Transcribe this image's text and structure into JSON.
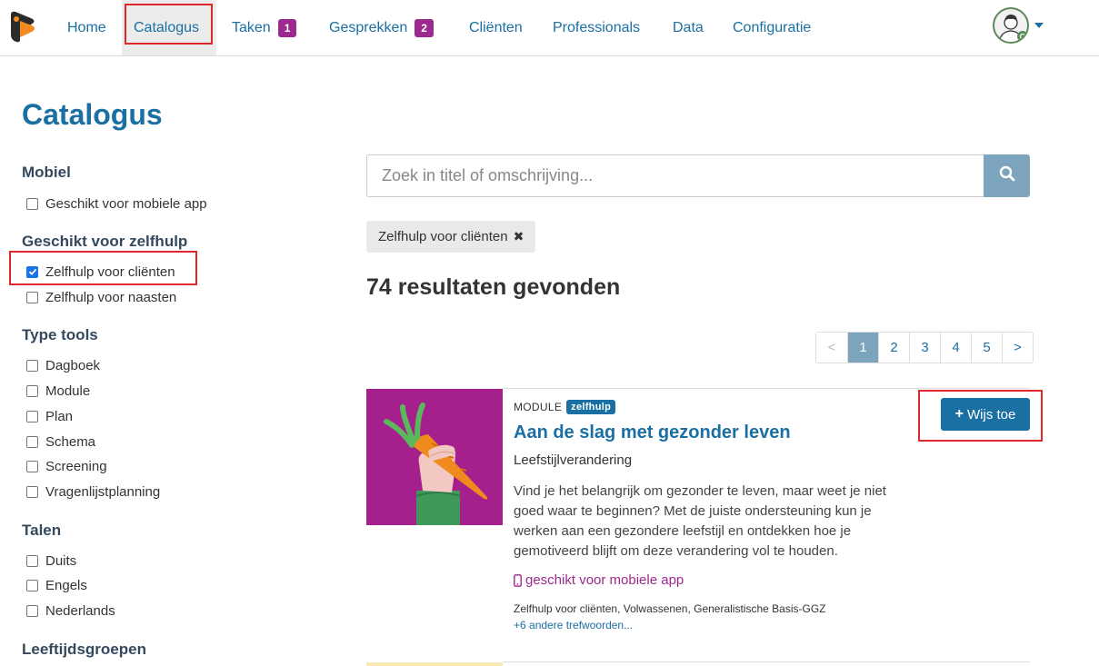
{
  "nav": {
    "items": [
      {
        "label": "Home"
      },
      {
        "label": "Catalogus"
      },
      {
        "label": "Taken",
        "badge": "1"
      },
      {
        "label": "Gesprekken",
        "badge": "2"
      },
      {
        "label": "Cliënten"
      },
      {
        "label": "Professionals"
      },
      {
        "label": "Data"
      },
      {
        "label": "Configuratie"
      }
    ],
    "active": "Catalogus"
  },
  "page": {
    "title": "Catalogus"
  },
  "filters": [
    {
      "heading": "Mobiel",
      "options": [
        {
          "label": "Geschikt voor mobiele app",
          "checked": false
        }
      ]
    },
    {
      "heading": "Geschikt voor zelfhulp",
      "options": [
        {
          "label": "Zelfhulp voor cliënten",
          "checked": true
        },
        {
          "label": "Zelfhulp voor naasten",
          "checked": false
        }
      ]
    },
    {
      "heading": "Type tools",
      "options": [
        {
          "label": "Dagboek",
          "checked": false
        },
        {
          "label": "Module",
          "checked": false
        },
        {
          "label": "Plan",
          "checked": false
        },
        {
          "label": "Schema",
          "checked": false
        },
        {
          "label": "Screening",
          "checked": false
        },
        {
          "label": "Vragenlijstplanning",
          "checked": false
        }
      ]
    },
    {
      "heading": "Talen",
      "options": [
        {
          "label": "Duits",
          "checked": false
        },
        {
          "label": "Engels",
          "checked": false
        },
        {
          "label": "Nederlands",
          "checked": false
        }
      ]
    },
    {
      "heading": "Leeftijdsgroepen",
      "options": []
    }
  ],
  "search": {
    "placeholder": "Zoek in titel of omschrijving...",
    "value": ""
  },
  "active_filter": {
    "label": "Zelfhulp voor cliënten",
    "remove_glyph": "✖"
  },
  "results": {
    "count_text": "74 resultaten gevonden"
  },
  "pagination": {
    "prev": "<",
    "next": ">",
    "pages": [
      "1",
      "2",
      "3",
      "4",
      "5"
    ],
    "current": "1"
  },
  "card": {
    "type": "MODULE",
    "badge": "zelfhulp",
    "title": "Aan de slag met gezonder leven",
    "subtitle": "Leefstijlverandering",
    "description": "Vind je het belangrijk om gezonder te leven, maar weet je niet goed waar te beginnen? Met de juiste ondersteuning kun je werken aan een gezondere leefstijl en ontdekken hoe je gemotiveerd blijft om deze verandering vol te houden.",
    "mobile_label": "geschikt voor mobiele app",
    "tags": "Zelfhulp voor cliënten, Volwassenen, Generalistische Basis-GGZ",
    "more_tags": "+6 andere trefwoorden...",
    "button_label": "Wijs toe",
    "button_icon": "+"
  },
  "colors": {
    "primary": "#1a6fa3",
    "badge": "#9c2a8e",
    "card_image_bg": "#a6208d",
    "search_button": "#7ca4bd",
    "highlight": "#e0272b"
  },
  "icons": [
    "app-logo-icon",
    "search-icon",
    "user-avatar-icon",
    "caret-down-icon",
    "mobile-phone-icon",
    "plus-icon",
    "close-icon"
  ]
}
